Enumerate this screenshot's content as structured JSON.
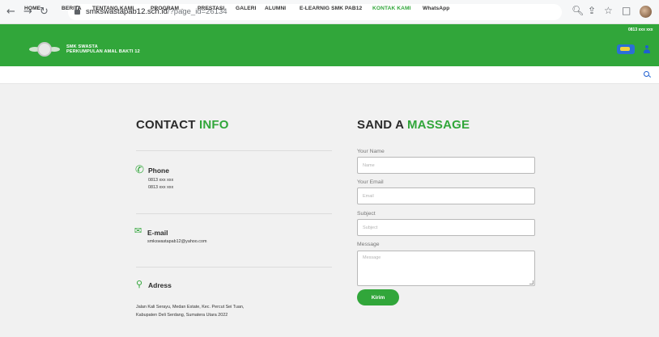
{
  "browser": {
    "back_icon": "arrow-left-icon",
    "forward_icon": "arrow-right-icon",
    "reload_icon": "reload-icon",
    "url_host": "smkswastapab12.sch.id",
    "url_path": "/?page_id=26134"
  },
  "header": {
    "school_line1": "SMK SWASTA",
    "school_line2": "PERKUMPULAN AMAL BAKTI 12",
    "phone": "0813 xxx xxx",
    "brand_color": "#31a63a"
  },
  "menu": {
    "items": [
      {
        "label": "HOME"
      },
      {
        "label": "BERITA"
      },
      {
        "label": "TENTANG KAMI"
      },
      {
        "label": "PROGRAM"
      },
      {
        "label": "PRESTASI"
      },
      {
        "label": "GALERI"
      },
      {
        "label": "ALUMNI"
      },
      {
        "label": "E-LEARNIG SMK PAB12"
      },
      {
        "label": "KONTAK KAMI"
      },
      {
        "label": "WhatsApp"
      }
    ]
  },
  "contact_info": {
    "heading_main": "CONTACT ",
    "heading_accent": "INFO",
    "phone_title": "Phone",
    "phone_1": "0813 xxx xxx",
    "phone_2": "0813 xxx xxx",
    "email_title": "E-mail",
    "email_value": "smkswastapab12@yahoo.com",
    "address_title": "Adress",
    "address_line1": "Jalan Kali Serayu, Medan Estate, Kec. Percut Sei Tuan,",
    "address_line2": "Kabupaten Deli Serdang, Sumatera Utara 2022"
  },
  "form": {
    "heading_main": "SAND A ",
    "heading_accent": "MASSAGE",
    "name_label": "Your Name",
    "name_placeholder": "Name",
    "email_label": "Your Email",
    "email_placeholder": "Email",
    "subject_label": "Subject",
    "subject_placeholder": "Subject",
    "message_label": "Message",
    "message_placeholder": "Message",
    "submit_label": "Kirim"
  }
}
